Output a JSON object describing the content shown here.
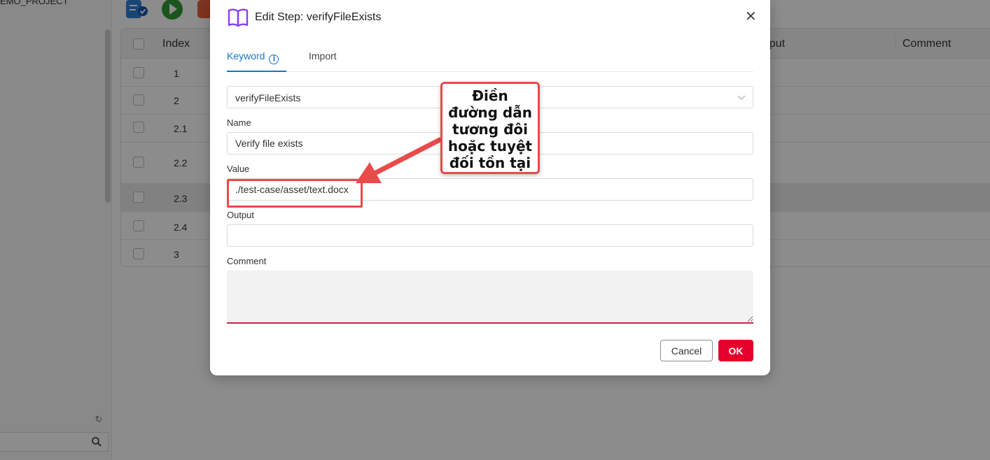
{
  "sidebar": {
    "project_name": "EMO_PROJECT",
    "search_placeholder": ""
  },
  "grid": {
    "headers": {
      "index": "Index",
      "output": "Output",
      "comment": "Comment"
    },
    "rows": [
      {
        "index": "1"
      },
      {
        "index": "2"
      },
      {
        "index": "2.1"
      },
      {
        "index": "2.2"
      },
      {
        "index": "2.3"
      },
      {
        "index": "2.4"
      },
      {
        "index": "3"
      }
    ]
  },
  "modal": {
    "title": "Edit Step: verifyFileExists",
    "tabs": {
      "keyword": "Keyword",
      "import": "Import"
    },
    "keyword_select": "verifyFileExists",
    "fields": {
      "name_label": "Name",
      "name_value": "Verify file exists",
      "value_label": "Value",
      "value_value": "./test-case/asset/text.docx",
      "output_label": "Output",
      "output_value": "",
      "comment_label": "Comment",
      "comment_value": ""
    },
    "buttons": {
      "cancel": "Cancel",
      "ok": "OK"
    }
  },
  "annotation": {
    "callout_text": "Điền đường dẫn tương đôi hoặc tuyệt đối tồn tại"
  },
  "colors": {
    "accent": "#1677c8",
    "primary_button": "#e5002b",
    "annotation": "#e94a4a"
  }
}
